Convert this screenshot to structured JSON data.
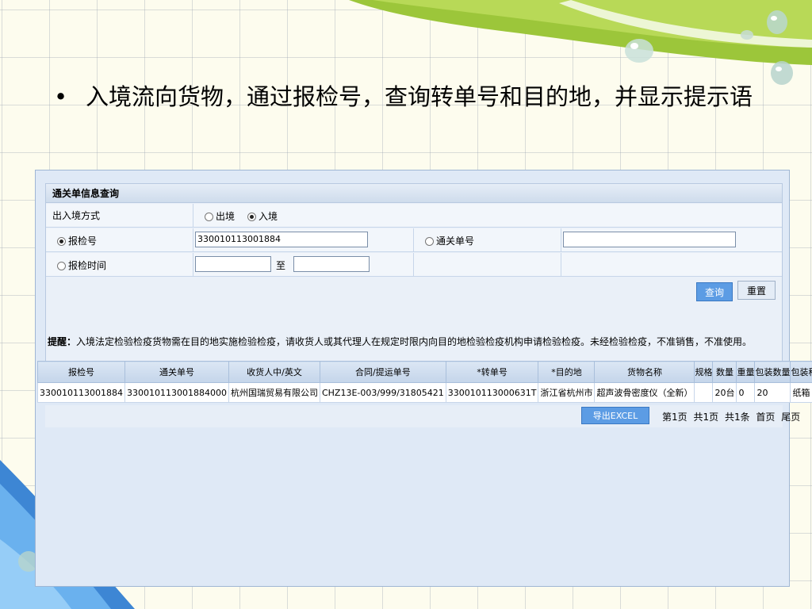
{
  "slide": {
    "bullet": "•",
    "text": "入境流向货物，通过报检号，查询转单号和目的地，并显示提示语"
  },
  "panel": {
    "title": "通关单信息查询",
    "direction_label": "出入境方式",
    "direction_options": [
      "出境",
      "入境"
    ],
    "direction_selected": "入境",
    "inspection_no_label": "报检号",
    "inspection_no_value": "330010113001884",
    "customs_no_label": "通关单号",
    "customs_no_value": "",
    "inspection_time_label": "报检时间",
    "time_from_value": "",
    "time_to_label": "至",
    "time_to_value": "",
    "query_button": "查询",
    "reset_button": "重置",
    "notice_label": "提醒：",
    "notice_text": "入境法定检验检疫货物需在目的地实施检验检疫，请收货人或其代理人在规定时限内向目的地检验检疫机构申请检验检疫。未经检验检疫，不准销售，不准使用。"
  },
  "table": {
    "headers": [
      "报检号",
      "通关单号",
      "收货人中/英文",
      "合同/提运单号",
      "*转单号",
      "*目的地",
      "货物名称",
      "规格",
      "数量",
      "重量",
      "包装数量",
      "包装种类"
    ],
    "rows": [
      [
        "330010113001884",
        "330010113001884000",
        "杭州国瑞贸易有限公司",
        "CHZ13E-003/999/31805421",
        "330010113000631T",
        "浙江省杭州市",
        "超声波骨密度仪（全新）",
        "",
        "20台",
        "0",
        "20",
        "纸箱"
      ]
    ]
  },
  "footer": {
    "export_button": "导出EXCEL",
    "page_current": "第1页",
    "page_total": "共1页",
    "record_total": "共1条",
    "first_page": "首页",
    "last_page": "尾页"
  }
}
